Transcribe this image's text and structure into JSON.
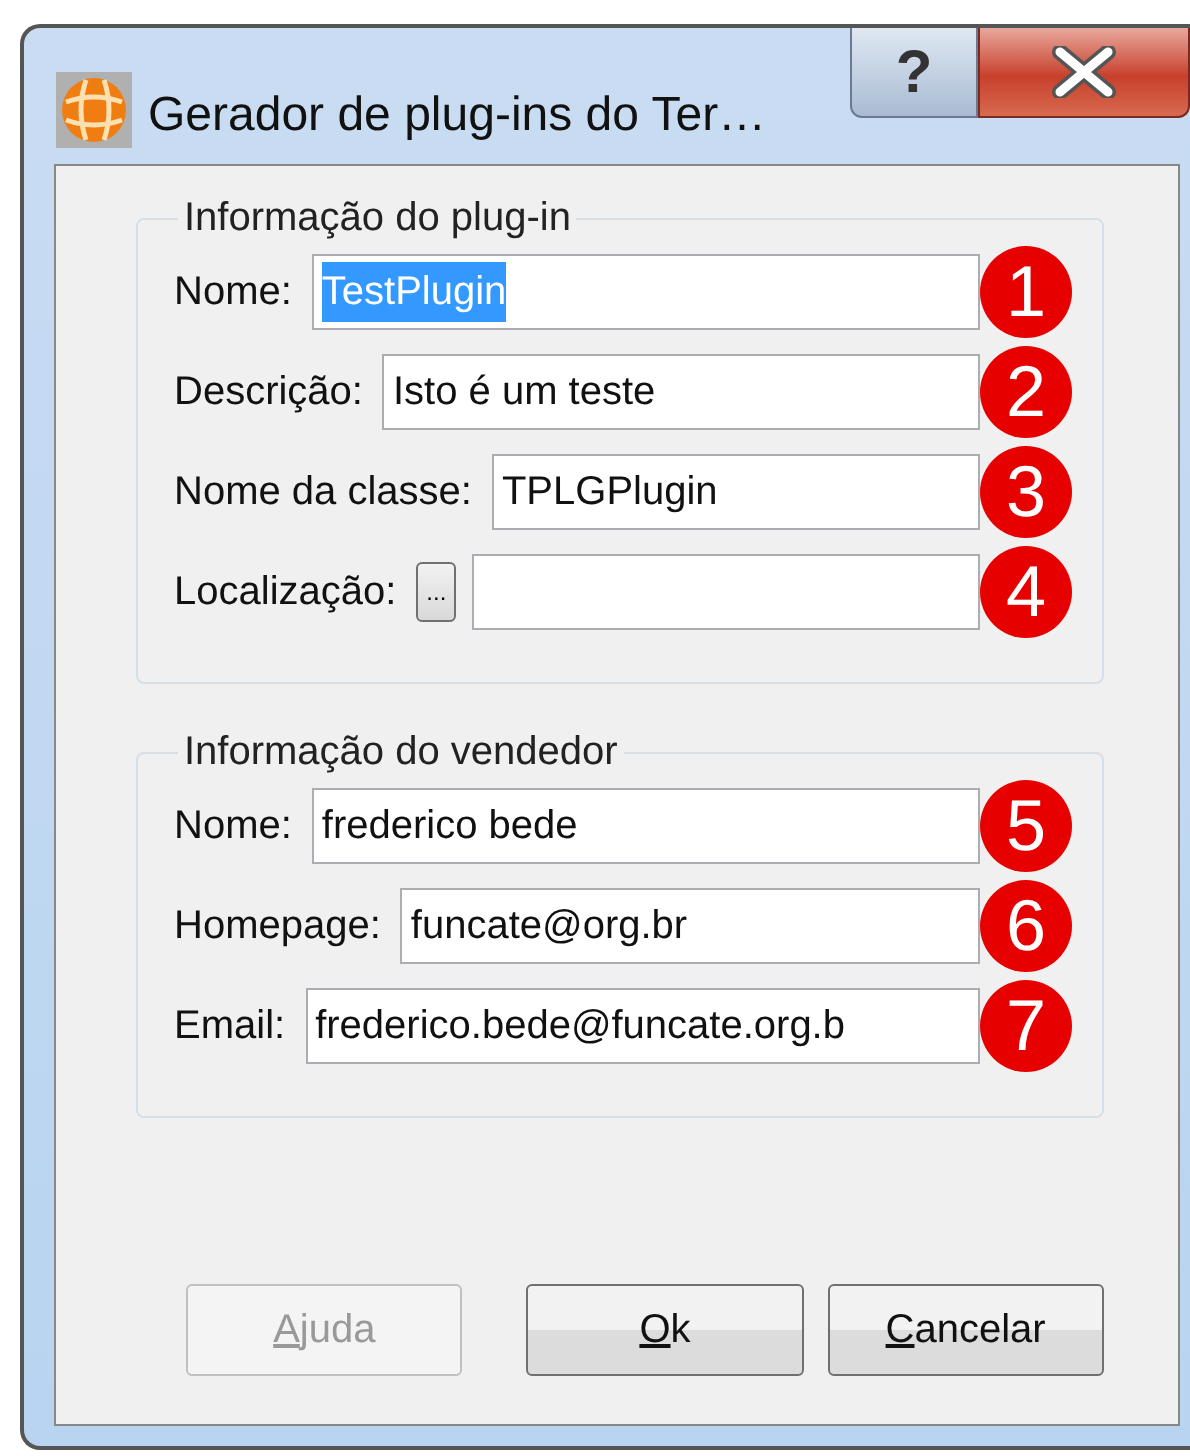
{
  "window": {
    "title": "Gerador de plug-ins do Ter…",
    "help_button": "?"
  },
  "groups": [
    {
      "legend": "Informação do plug-in",
      "fields": [
        {
          "label": "Nome:",
          "value": "TestPlugin",
          "text_selected": true,
          "kind": "text",
          "marker": "1"
        },
        {
          "label": "Descrição:",
          "value": "Isto é um teste",
          "text_selected": false,
          "kind": "text",
          "marker": "2"
        },
        {
          "label": "Nome da classe:",
          "value": "TPLGPlugin",
          "text_selected": false,
          "kind": "text",
          "marker": "3"
        },
        {
          "label": "Localização:",
          "browse_button": "...",
          "kind": "browse",
          "marker": "4"
        }
      ]
    },
    {
      "legend": "Informação do vendedor",
      "fields": [
        {
          "label": "Nome:",
          "value": "frederico bede",
          "text_selected": false,
          "kind": "text",
          "marker": "5"
        },
        {
          "label": "Homepage:",
          "value": "funcate@org.br",
          "text_selected": false,
          "kind": "text",
          "marker": "6"
        },
        {
          "label": "Email:",
          "value": "frederico.bede@funcate.org.b",
          "text_selected": false,
          "kind": "text",
          "marker": "7"
        }
      ]
    }
  ],
  "buttons": [
    {
      "label": "Ajuda",
      "disabled": true,
      "underline_first": true
    },
    {
      "label": "Ok",
      "disabled": false,
      "underline_first": true
    },
    {
      "label": "Cancelar",
      "disabled": false,
      "underline_first": true
    }
  ]
}
